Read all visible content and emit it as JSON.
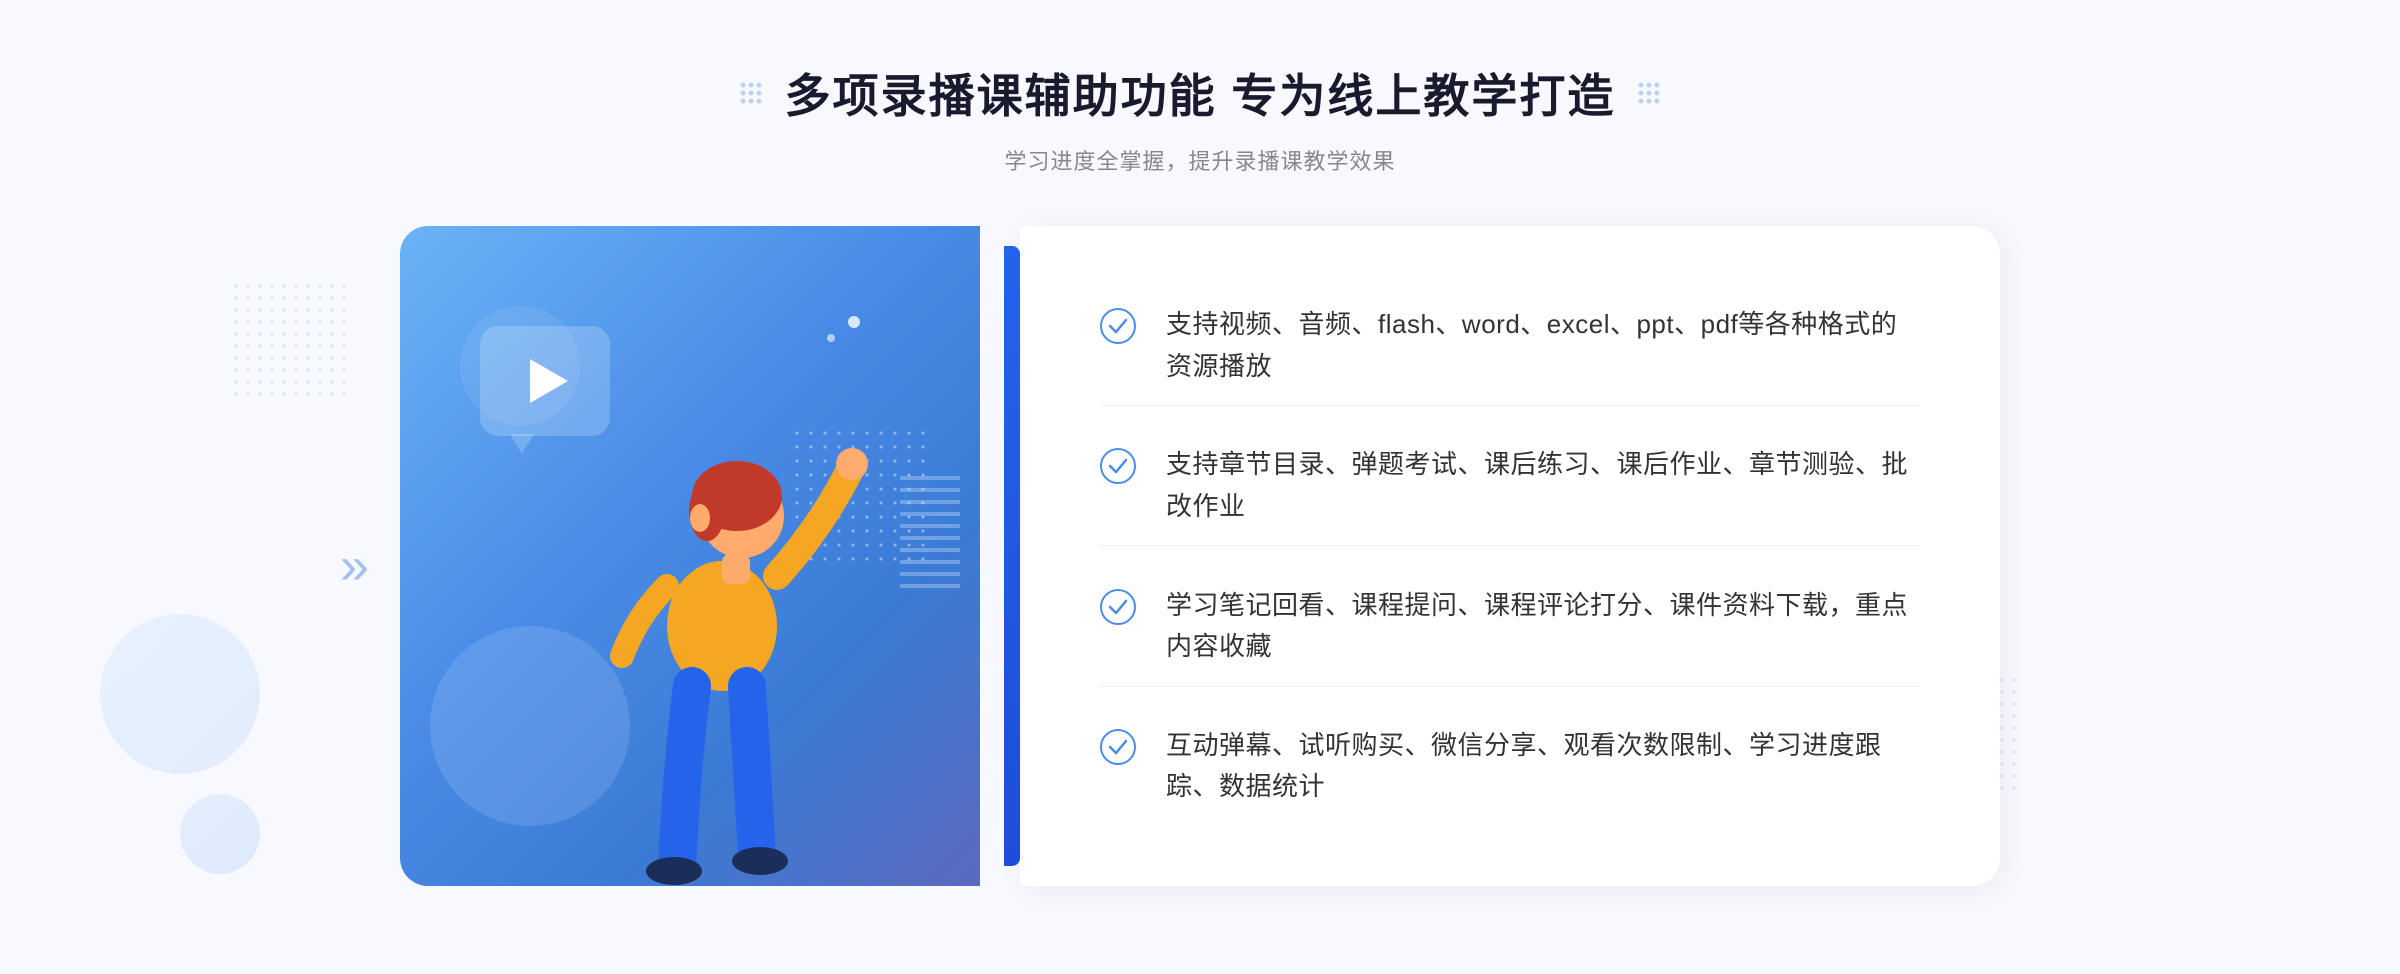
{
  "page": {
    "background_color": "#f8f9ff"
  },
  "header": {
    "title": "多项录播课辅助功能 专为线上教学打造",
    "subtitle": "学习进度全掌握，提升录播课教学效果"
  },
  "features": [
    {
      "id": 1,
      "text": "支持视频、音频、flash、word、excel、ppt、pdf等各种格式的资源播放"
    },
    {
      "id": 2,
      "text": "支持章节目录、弹题考试、课后练习、课后作业、章节测验、批改作业"
    },
    {
      "id": 3,
      "text": "学习笔记回看、课程提问、课程评论打分、课件资料下载，重点内容收藏"
    },
    {
      "id": 4,
      "text": "互动弹幕、试听购买、微信分享、观看次数限制、学习进度跟踪、数据统计"
    }
  ],
  "decoration": {
    "chevron": "»",
    "check_color": "#4a8de8",
    "title_deco_color": "#c0d0f0"
  }
}
